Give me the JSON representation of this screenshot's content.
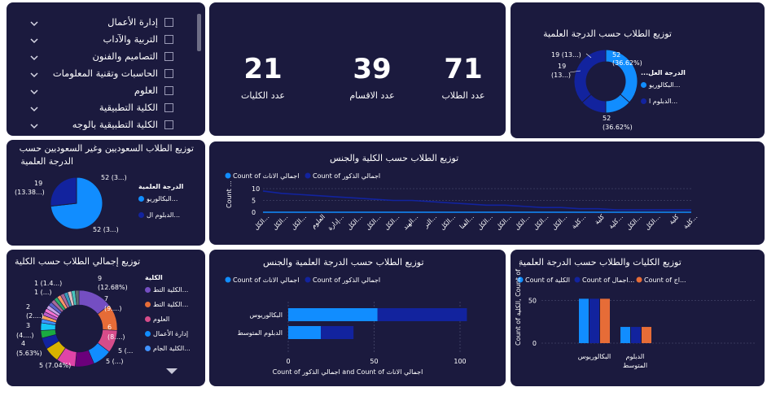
{
  "colors": {
    "panel": "#1b1a3e",
    "primary": "#118dff",
    "secondary": "#12239e",
    "orange": "#e66c37",
    "grid": "#55567a"
  },
  "slicer": {
    "items": [
      "إدارة الأعمال",
      "التربية والآداب",
      "التصاميم والفنون",
      "الحاسبات وتقنية المعلومات",
      "العلوم",
      "الكلية التطبيقية",
      "الكلية التطبيقية بالوجه"
    ]
  },
  "kpis": [
    {
      "value": "71",
      "label": "عدد الطلاب"
    },
    {
      "value": "39",
      "label": "عدد الاقسام"
    },
    {
      "value": "21",
      "label": "عدد الكليات"
    }
  ],
  "donut_degree": {
    "title": "توزيع الطلاب حسب الدرجة العلمية",
    "legend_title": "الدرجة العل...",
    "legend": [
      "البكالوريو...",
      "الدبلوم ا..."
    ],
    "labels": {
      "top_left_1": "19 (13...)",
      "top_left_2": "19",
      "top_left_3": "(13...)",
      "top_right_1": "52",
      "top_right_2": "(36.62%)",
      "bottom_right_1": "52",
      "bottom_right_2": "(36.62%)"
    }
  },
  "pie_saudi": {
    "title_line1": "توزيع الطلاب السعوديين وغير السعوديين حسب",
    "title_line2": "الدرجة العلمية",
    "legend_title": "الدرجة العلمية",
    "legend": [
      "البكالوريو...",
      "الدبلوم ال..."
    ],
    "labels": {
      "left_1": "19",
      "left_2": "(13.38...)",
      "top_right": "52 (3...)",
      "bottom": "52 (3...)"
    }
  },
  "gender_line": {
    "title": "توزيع الطلاب حسب الكلية والجنس",
    "legend": [
      "Count of اجمالي الاناث",
      "Count of اجمالي الذكور"
    ],
    "yaxis_label": "Count ...",
    "y_ticks": [
      "10",
      "5",
      "0"
    ],
    "x_ticks": [
      "الكل...",
      "الكل...",
      "الكل...",
      "العلوم",
      "إدارة...",
      "الكل...",
      "الكل...",
      "الكل...",
      "الهند...",
      "التر...",
      "الكل...",
      "الفنا...",
      "الكل...",
      "الكل...",
      "الكل...",
      "الكل...",
      "الكل...",
      "كلية...",
      "كلية",
      "كلية...",
      "الكل...",
      "الكل...",
      "كلية",
      "كلية..."
    ]
  },
  "pie_college": {
    "title": "توزيع إجمالي الطلاب حسب الكلية",
    "legend_title": "الكلية",
    "legend": [
      "الكلية التط...",
      "الكلية التط...",
      "العلوم",
      "إدارة الأعمال",
      "الكلية الجام..."
    ],
    "labels": {
      "l1": "1 (1.4...)",
      "l2": "1 (...)",
      "l3": "2",
      "l4": "(2....)",
      "l5": "3",
      "l6": "(4....)",
      "l7": "4",
      "l8": "(5.63%)",
      "l9": "5 (7.04%)",
      "r1": "9",
      "r2": "(12.68%)",
      "r3": "7",
      "r4": "(9....)",
      "r5": "6",
      "r6": "(8....)",
      "r7": "5 (...",
      "r8": "5 (...)"
    }
  },
  "gender_bar": {
    "title": "توزيع الطلاب حسب الدرجة العلمية والجنس",
    "legend": [
      "Count of اجمالي الاناث",
      "Count of اجمالي الذكور"
    ],
    "categories": [
      "البكالوريوس",
      "الدبلوم المتوسط"
    ],
    "x_ticks": [
      "0",
      "50",
      "100"
    ],
    "xlabel": "Count of اجمالي الذكور and Count of اجمالي الاناث"
  },
  "college_bar": {
    "title": "توزيع الكليات والطلاب حسب الدرجة العلمية",
    "legend": [
      "Count of الكلية",
      "Count of اجمال...",
      "Count of اج..."
    ],
    "ylabel": "Count of الكلية, Count of ...",
    "y_ticks": [
      "50",
      "0"
    ],
    "categories": [
      "البكالوريوس",
      "الدبلوم المتوسط"
    ]
  },
  "chart_data": [
    {
      "type": "pie",
      "title": "توزيع الطلاب حسب الدرجة العلمية",
      "categories": [
        "البكالوريوس",
        "الدبلوم المتوسط",
        "البكالوريوس",
        "الدبلوم المتوسط"
      ],
      "values": [
        52,
        19,
        52,
        19
      ]
    },
    {
      "type": "pie",
      "title": "توزيع الطلاب السعوديين وغير السعوديين حسب الدرجة العلمية",
      "categories": [
        "البكالوريوس",
        "الدبلوم المتوسط"
      ],
      "values": [
        52,
        19
      ]
    },
    {
      "type": "line",
      "title": "توزيع الطلاب حسب الكلية والجنس",
      "ylim": [
        0,
        10
      ],
      "series": [
        {
          "name": "Count of اجمالي الاناث",
          "values": [
            9,
            8,
            7.5,
            7,
            6.5,
            6,
            5.5,
            5,
            5,
            4.5,
            4,
            3.5,
            3,
            3,
            2.5,
            2,
            2,
            1.5,
            1.5,
            1,
            1,
            1,
            1,
            1
          ]
        },
        {
          "name": "Count of اجمالي الذكور",
          "values": [
            0,
            0,
            0,
            0,
            0,
            0,
            0,
            0,
            0,
            0,
            0,
            0,
            0,
            0,
            0,
            0,
            0,
            0,
            0,
            0,
            0,
            0,
            0,
            0
          ]
        }
      ]
    },
    {
      "type": "pie",
      "title": "توزيع إجمالي الطلاب حسب الكلية",
      "values": [
        9,
        7,
        6,
        5,
        5,
        5,
        4,
        3,
        2,
        2,
        1,
        1,
        1,
        1,
        1,
        1,
        1,
        1,
        1,
        1,
        1,
        1,
        1,
        1
      ],
      "colors": [
        "#744ec2",
        "#e66c37",
        "#d64c8a",
        "#118dff",
        "#6b007b",
        "#e044a7",
        "#d9b300",
        "#12239e",
        "#1aab40",
        "#15c6f4",
        "#4092ff",
        "#ffa058",
        "#be5dc9",
        "#f472d0",
        "#c5a2e6",
        "#5b60c9",
        "#a66999",
        "#2eaa6a",
        "#fe9666",
        "#a66999",
        "#3599b8",
        "#dfbfbf",
        "#4ac5bb",
        "#5f6b6d"
      ]
    },
    {
      "type": "bar",
      "title": "توزيع الطلاب حسب الدرجة العلمية والجنس",
      "categories": [
        "البكالوريوس",
        "الدبلوم المتوسط"
      ],
      "xlim": [
        0,
        100
      ],
      "series": [
        {
          "name": "Count of اجمالي الاناث",
          "values": [
            52,
            19
          ]
        },
        {
          "name": "Count of اجمالي الذكور",
          "values": [
            52,
            19
          ]
        }
      ]
    },
    {
      "type": "bar",
      "title": "توزيع الكليات والطلاب حسب الدرجة العلمية",
      "categories": [
        "البكالوريوس",
        "الدبلوم المتوسط"
      ],
      "ylim": [
        0,
        60
      ],
      "series": [
        {
          "name": "Count of الكلية",
          "values": [
            52,
            19
          ]
        },
        {
          "name": "Count of اجمال...",
          "values": [
            52,
            19
          ]
        },
        {
          "name": "Count of اج...",
          "values": [
            52,
            19
          ]
        }
      ]
    }
  ]
}
